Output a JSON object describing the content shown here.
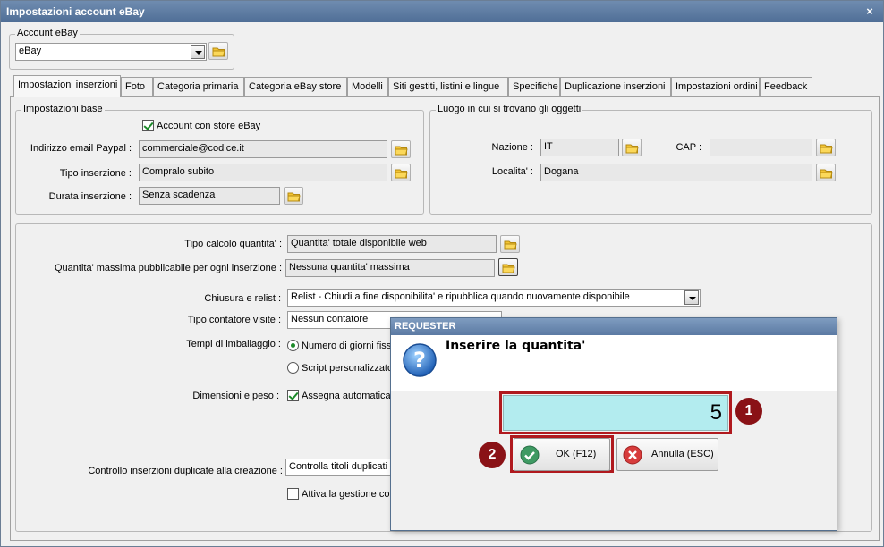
{
  "window": {
    "title": "Impostazioni account eBay",
    "close_glyph": "×"
  },
  "account": {
    "legend": "Account eBay",
    "selected": "eBay"
  },
  "tabs": [
    {
      "label": "Impostazioni inserzioni"
    },
    {
      "label": "Foto"
    },
    {
      "label": "Categoria primaria"
    },
    {
      "label": "Categoria eBay store"
    },
    {
      "label": "Modelli"
    },
    {
      "label": "Siti gestiti, listini e lingue"
    },
    {
      "label": "Specifiche"
    },
    {
      "label": "Duplicazione inserzioni"
    },
    {
      "label": "Impostazioni ordini"
    },
    {
      "label": "Feedback"
    }
  ],
  "base": {
    "legend": "Impostazioni base",
    "store_check": "Account con store eBay",
    "paypal_label": "Indirizzo email Paypal :",
    "paypal_value": "commerciale@codice.it",
    "tipo_label": "Tipo inserzione :",
    "tipo_value": "Compralo subito",
    "durata_label": "Durata inserzione :",
    "durata_value": "Senza scadenza"
  },
  "location": {
    "legend": "Luogo in cui si trovano gli oggetti",
    "nazione_label": "Nazione :",
    "nazione_value": "IT",
    "cap_label": "CAP :",
    "cap_value": "",
    "localita_label": "Localita' :",
    "localita_value": "Dogana"
  },
  "details": {
    "calcolo_label": "Tipo calcolo quantita' :",
    "calcolo_value": "Quantita' totale disponibile web",
    "max_label": "Quantita' massima pubblicabile per ogni inserzione :",
    "max_value": "Nessuna quantita' massima",
    "chiusura_label": "Chiusura e relist :",
    "chiusura_value": "Relist - Chiudi a fine disponibilita' e ripubblica quando nuovamente disponibile",
    "contatore_label": "Tipo contatore visite :",
    "contatore_value": "Nessun contatore",
    "imballaggio_label": "Tempi di imballaggio :",
    "imballaggio_opt1": "Numero di giorni fisso",
    "imballaggio_opt2": "Script personalizzato",
    "dimensioni_label": "Dimensioni e peso :",
    "dimensioni_check": "Assegna automaticam",
    "duplicate_label": "Controllo inserzioni duplicate alla creazione :",
    "duplicate_value": "Controlla titoli duplicati e",
    "compat_check": "Attiva la gestione compatibilita'  (la compatibilita' verra' impostata solo per le nuove inserzioni create con Ready Pro)"
  },
  "dialog": {
    "title": "REQUESTER",
    "message": "Inserire la quantita'",
    "quantity": "5",
    "ok_label": "OK (F12)",
    "cancel_label": "Annulla (ESC)",
    "marker1": "1",
    "marker2": "2"
  },
  "colors": {
    "accent": "#b0191e",
    "input_highlight": "#b3ecef",
    "titlebar": "#5b7aa3"
  }
}
